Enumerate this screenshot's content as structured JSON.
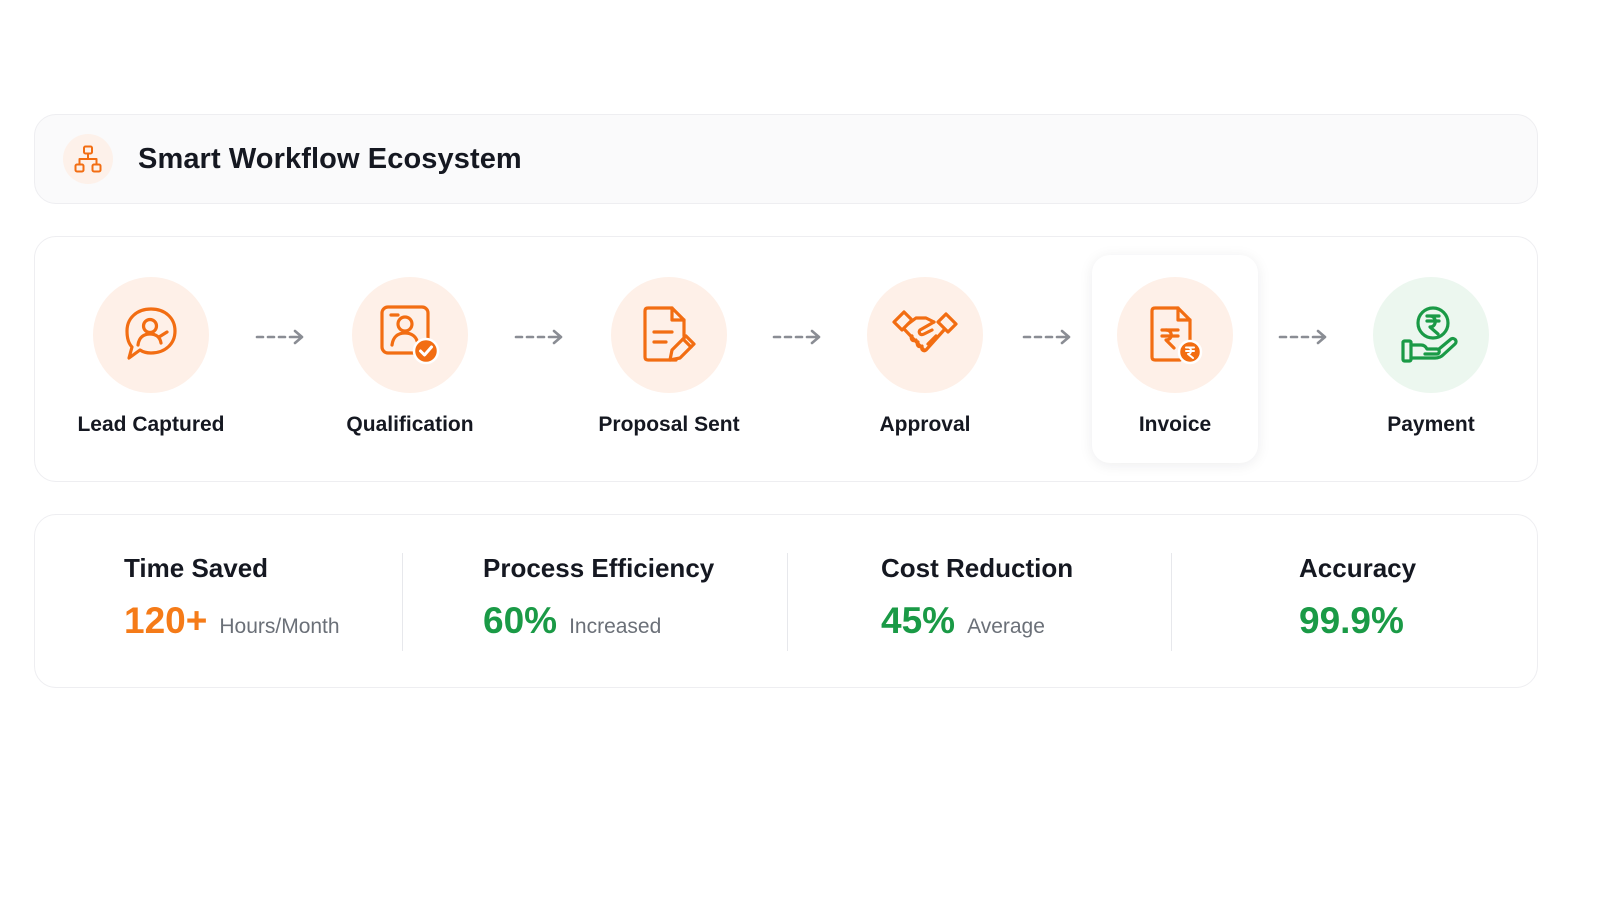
{
  "header": {
    "title": "Smart Workflow Ecosystem",
    "icon": "hierarchy-icon"
  },
  "workflow": {
    "steps": [
      {
        "label": "Lead Captured",
        "icon": "lead-chat-icon",
        "color": "#f26d12"
      },
      {
        "label": "Qualification",
        "icon": "qualified-profile-icon",
        "color": "#f26d12"
      },
      {
        "label": "Proposal Sent",
        "icon": "document-edit-icon",
        "color": "#f26d12"
      },
      {
        "label": "Approval",
        "icon": "handshake-icon",
        "color": "#f26d12"
      },
      {
        "label": "Invoice",
        "icon": "rupee-invoice-icon",
        "color": "#f26d12",
        "highlighted": true
      },
      {
        "label": "Payment",
        "icon": "rupee-hand-icon",
        "color": "#1a9a46"
      }
    ]
  },
  "stats": [
    {
      "title": "Time Saved",
      "value": "120+",
      "unit": "Hours/Month",
      "color": "#f57b18"
    },
    {
      "title": "Process Efficiency",
      "value": "60%",
      "unit": "Increased",
      "color": "#1a9a46"
    },
    {
      "title": "Cost Reduction",
      "value": "45%",
      "unit": "Average",
      "color": "#1a9a46"
    },
    {
      "title": "Accuracy",
      "value": "99.9%",
      "unit": "",
      "color": "#1a9a46"
    }
  ],
  "colors": {
    "accent_orange": "#f26d12",
    "accent_green": "#1a9a46",
    "arrow_gray": "#8a8d94"
  }
}
